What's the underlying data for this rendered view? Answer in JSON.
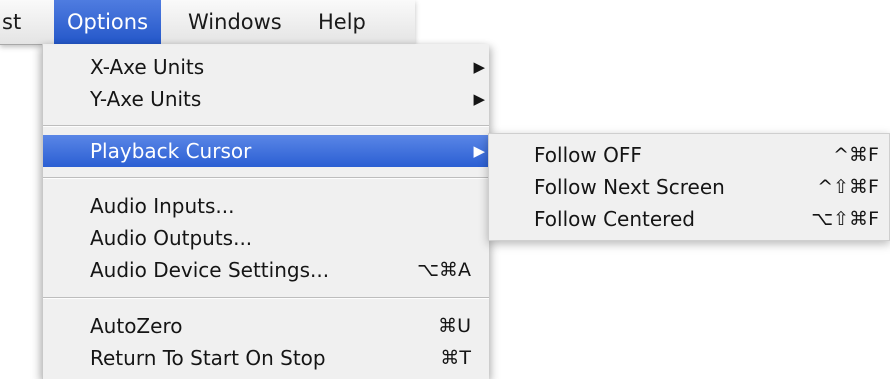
{
  "menubar": {
    "items": [
      {
        "label": "st"
      },
      {
        "label": "Options"
      },
      {
        "label": "Windows"
      },
      {
        "label": "Help"
      }
    ]
  },
  "options_menu": {
    "x_axe_units": {
      "label": "X-Axe Units",
      "arrow": "▶"
    },
    "y_axe_units": {
      "label": "Y-Axe Units",
      "arrow": "▶"
    },
    "playback_cursor": {
      "label": "Playback Cursor",
      "arrow": "▶"
    },
    "audio_inputs": {
      "label": "Audio Inputs..."
    },
    "audio_outputs": {
      "label": "Audio Outputs..."
    },
    "audio_device_settings": {
      "label": "Audio Device Settings...",
      "shortcut": "⌥⌘A"
    },
    "autozero": {
      "label": "AutoZero",
      "shortcut": "⌘U"
    },
    "return_to_start": {
      "label": "Return To Start On Stop",
      "shortcut": "⌘T"
    }
  },
  "playback_submenu": {
    "items": [
      {
        "label": "Follow OFF",
        "shortcut": "^⌘F"
      },
      {
        "label": "Follow Next Screen",
        "shortcut": "^⇧⌘F"
      },
      {
        "label": "Follow Centered",
        "shortcut": "⌥⇧⌘F"
      }
    ]
  },
  "colors": {
    "highlight": "#2b5fd3",
    "menu_bg": "#f0f0f0",
    "separator": "#bdbdbd"
  }
}
